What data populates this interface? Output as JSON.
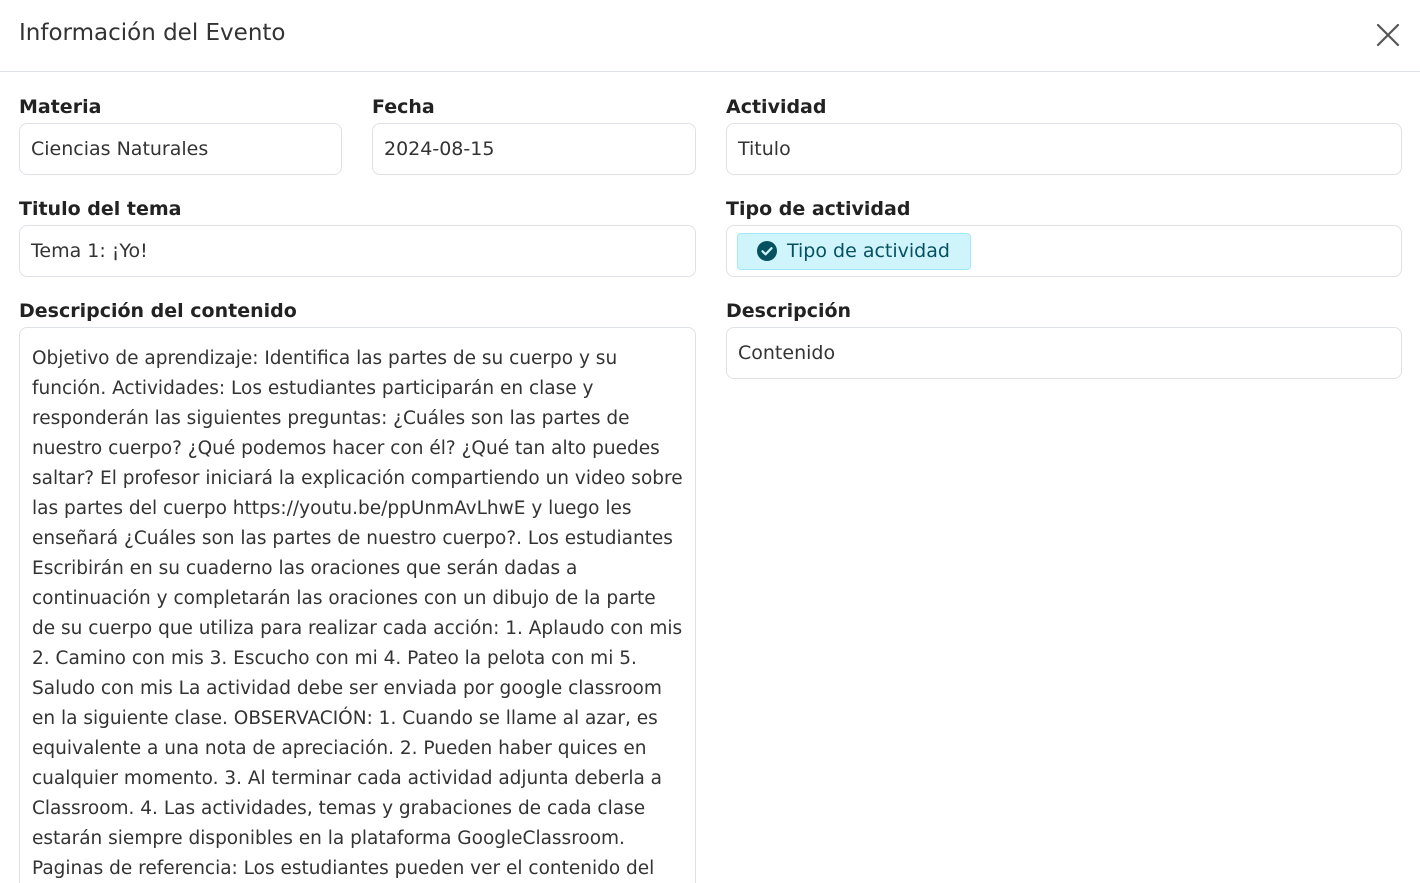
{
  "modal": {
    "title": "Información del Evento"
  },
  "form": {
    "materia": {
      "label": "Materia",
      "value": "Ciencias Naturales"
    },
    "fecha": {
      "label": "Fecha",
      "value": "2024-08-15"
    },
    "actividad": {
      "label": "Actividad",
      "value": "Titulo"
    },
    "titulo_tema": {
      "label": "Titulo del tema",
      "value": "Tema 1: ¡Yo!"
    },
    "tipo_actividad": {
      "label": "Tipo de actividad",
      "chip": "Tipo de actividad"
    },
    "descripcion_contenido": {
      "label": "Descripción del contenido",
      "value": "Objetivo de aprendizaje: Identifica las partes de su cuerpo y su función. Actividades: Los estudiantes participarán en clase y responderán las siguientes preguntas: ¿Cuáles son las partes de nuestro cuerpo? ¿Qué podemos hacer con él? ¿Qué tan alto puedes saltar? El profesor iniciará la explicación compartiendo un video sobre las partes del cuerpo https://youtu.be/ppUnmAvLhwE y luego les enseñará ¿Cuáles son las partes de nuestro cuerpo?. Los estudiantes Escribirán en su cuaderno las oraciones que serán dadas a continuación y completarán las oraciones con un dibujo de la parte de su cuerpo que utiliza para realizar cada acción: 1. Aplaudo con mis 2. Camino con mis 3. Escucho con mi 4. Pateo la pelota con mi 5. Saludo con mis La actividad debe ser enviada por google classroom en la siguiente clase. OBSERVACIÓN: 1. Cuando se llame al azar, es equivalente a una nota de apreciación. 2. Pueden haber quices en cualquier momento. 3. Al terminar cada actividad adjunta deberla a Classroom. 4. Las actividades, temas y grabaciones de cada clase estarán siempre disponibles en la plataforma GoogleClassroom. Paginas de referencia: Los estudiantes pueden ver el contenido del video para obtener más información sobre el tema:"
    },
    "descripcion": {
      "label": "Descripción",
      "value": "Contenido"
    }
  },
  "colors": {
    "chip_bg": "#cff4fc",
    "chip_text": "#055160",
    "border": "#dee2e6"
  },
  "icons": {
    "close": "close-icon",
    "check": "check-circle-icon"
  }
}
